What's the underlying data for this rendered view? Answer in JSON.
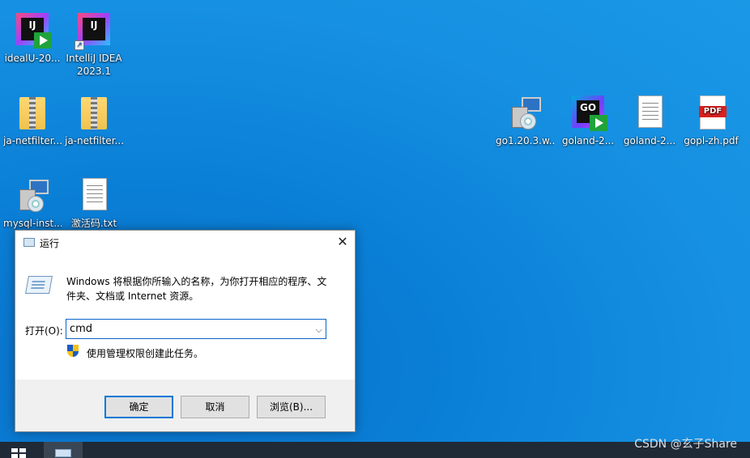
{
  "desktop": {
    "icons": [
      {
        "label": "idealU-20..."
      },
      {
        "label": "IntelliJ IDEA 2023.1"
      },
      {
        "label": "ja-netfilter..."
      },
      {
        "label": "ja-netfilter..."
      },
      {
        "label": "mysql-inst..."
      },
      {
        "label": "激活码.txt"
      },
      {
        "label": "go1.20.3.w..."
      },
      {
        "label": "goland-2..."
      },
      {
        "label": "goland-2..."
      },
      {
        "label": "gopl-zh.pdf"
      }
    ]
  },
  "icon_glyphs": {
    "ij": "IJ",
    "go": "GO",
    "pdf": "PDF"
  },
  "run_dialog": {
    "title": "运行",
    "close_glyph": "✕",
    "description": "Windows 将根据你所输入的名称，为你打开相应的程序、文件夹、文档或 Internet 资源。",
    "open_label": "打开(O):",
    "input_value": "cmd",
    "dropdown_glyph": "⌵",
    "admin_note": "使用管理权限创建此任务。",
    "buttons": {
      "ok": "确定",
      "cancel": "取消",
      "browse": "浏览(B)..."
    }
  },
  "watermark": "CSDN @玄子Share"
}
